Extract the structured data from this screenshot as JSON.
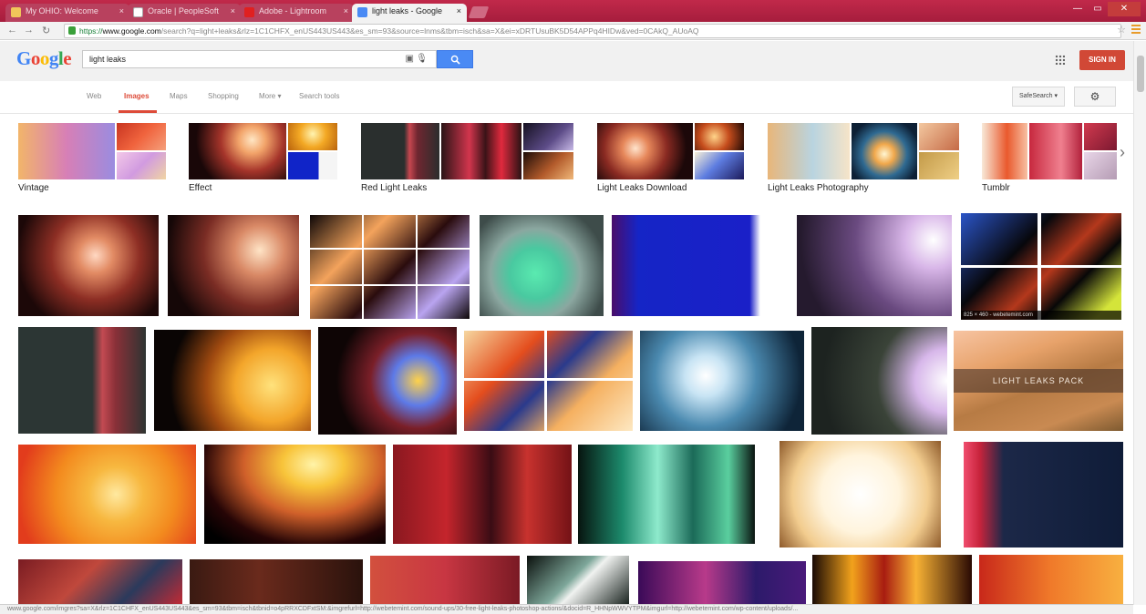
{
  "browser": {
    "tabs": [
      {
        "label": "My OHIO: Welcome",
        "left": 0
      },
      {
        "label": "Oracle | PeopleSoft",
        "left": 0
      },
      {
        "label": "Adobe - Lightroom",
        "left": 0
      },
      {
        "label": "light leaks - Google",
        "left": 0
      }
    ],
    "url_scheme": "https://",
    "url_host": "www.google.com",
    "url_rest": "/search?q=light+leaks&rlz=1C1CHFX_enUS443US443&es_sm=93&source=lnms&tbm=isch&sa=X&ei=xDRTUsuBK5D54APPq4HIDw&ved=0CAkQ_AUoAQ",
    "status_url": "www.google.com/imgres?sa=X&rlz=1C1CHFX_enUS443US443&es_sm=93&tbm=isch&tbnid=o4pRRXCDFxtSM:&imgrefurl=http://webetemint.com/sound-ups/30-free-light-leaks-photoshop-actions/&docid=R_HHNpWWVYTPM&imgurl=http://webetemint.com/wp-content/uploads/..."
  },
  "google": {
    "logo_letters": [
      "G",
      "o",
      "o",
      "g",
      "l",
      "e"
    ],
    "query": "light leaks",
    "search_icon": "magnifier-icon",
    "signin_label": "SIGN IN",
    "nav": [
      "Web",
      "Images",
      "Maps",
      "Shopping",
      "More ▾",
      "Search tools"
    ],
    "active_nav": "Images",
    "safesearch_label": "SafeSearch ▾"
  },
  "related": [
    {
      "label": "Vintage"
    },
    {
      "label": "Effect"
    },
    {
      "label": "Red Light Leaks"
    },
    {
      "label": "Light Leaks Download"
    },
    {
      "label": "Light Leaks Photography"
    },
    {
      "label": "Tumblr"
    }
  ],
  "overlays": {
    "size_caption": "825 × 460 - webetemint.com",
    "pack_caption": "LIGHT LEAKS PACK"
  },
  "colors": {
    "google_blue": "#4a8af4",
    "signin_red": "#d14836",
    "active_tab_red": "#dd4b39",
    "chrome_tabbar": "#b32246"
  }
}
